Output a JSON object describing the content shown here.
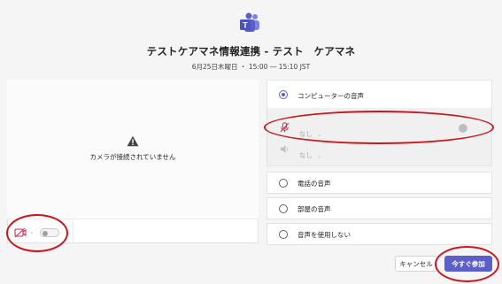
{
  "meeting": {
    "title": "テストケアマネ情報連携 - テスト　ケアマネ",
    "time": "6月25日木曜日 ・ 15:00 ― 15:10 JST"
  },
  "camera": {
    "status_message": "カメラが接続されていません",
    "video_on": false
  },
  "audio": {
    "options": [
      {
        "label": "コンピューターの音声",
        "selected": true
      },
      {
        "label": "電話の音声",
        "selected": false
      },
      {
        "label": "部屋の音声",
        "selected": false
      },
      {
        "label": "音声を使用しない",
        "selected": false
      }
    ],
    "mic_value": "なし",
    "speaker_value": "なし",
    "mic_on": false
  },
  "buttons": {
    "cancel": "キャンセル",
    "join_now": "今すぐ参加"
  },
  "colors": {
    "accent": "#5b5fc7",
    "annotation_ring": "#c8181d"
  },
  "icons": [
    "teams-logo-icon",
    "warning-icon",
    "camera-off-icon",
    "chevron-down-icon",
    "mic-off-icon",
    "speaker-icon"
  ]
}
